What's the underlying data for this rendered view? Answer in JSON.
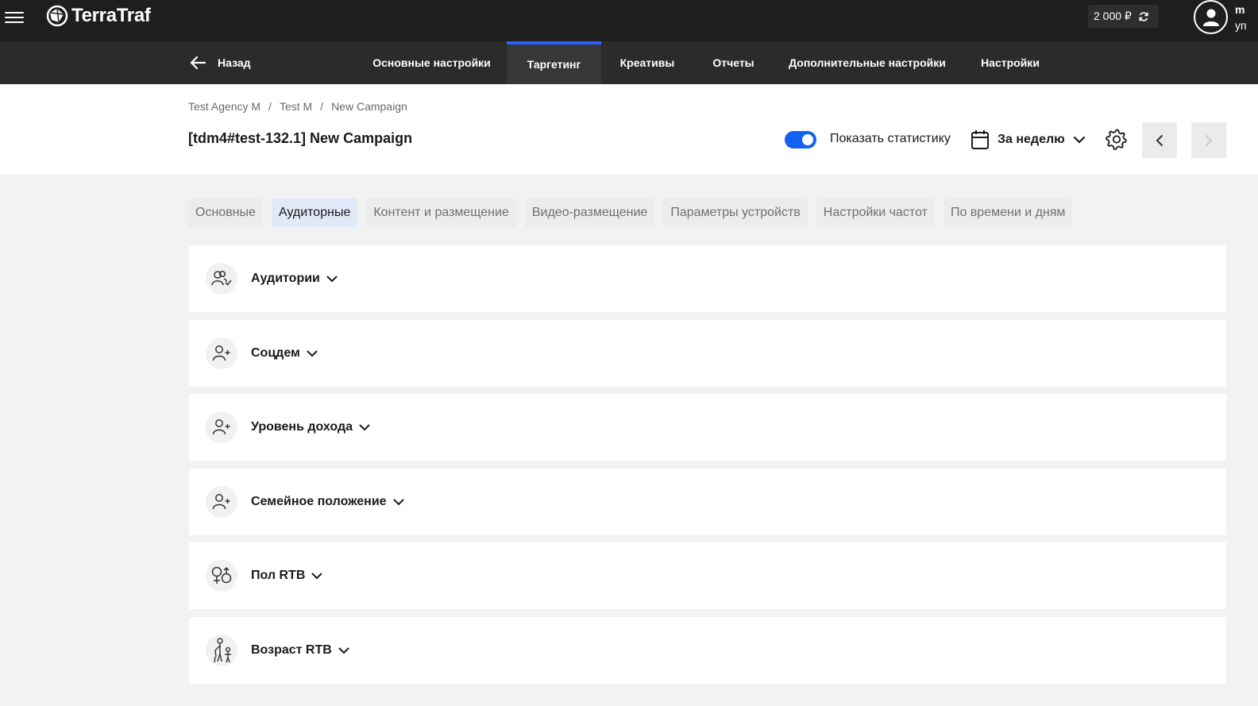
{
  "topbar": {
    "logo_text": "TerraTraf",
    "balance": "2 000 ₽",
    "user_initial": "m",
    "user_line2": "уп"
  },
  "nav": {
    "back_label": "Назад",
    "tabs": [
      {
        "label": "Основные настройки"
      },
      {
        "label": "Таргетинг"
      },
      {
        "label": "Креативы"
      },
      {
        "label": "Отчеты"
      },
      {
        "label": "Дополнительные настройки"
      },
      {
        "label": "Настройки"
      }
    ],
    "active_tab": "Таргетинг"
  },
  "breadcrumb": [
    "Test Agency M",
    "Test M",
    "New Campaign"
  ],
  "page_title": "[tdm4#test-132.1] New Campaign",
  "stats_toggle": {
    "label": "Показать статистику",
    "on": true
  },
  "period": {
    "label": "За неделю"
  },
  "subtabs": {
    "items": [
      {
        "label": "Основные"
      },
      {
        "label": "Аудиторные"
      },
      {
        "label": "Контент и размещение"
      },
      {
        "label": "Видео-размещение"
      },
      {
        "label": "Параметры устройств"
      },
      {
        "label": "Настройки частот"
      },
      {
        "label": "По времени и дням"
      }
    ],
    "active": "Аудиторные"
  },
  "sections": [
    {
      "label": "Аудитории",
      "icon": "users-check-icon"
    },
    {
      "label": "Соцдем",
      "icon": "user-plus-icon"
    },
    {
      "label": "Уровень дохода",
      "icon": "user-plus-icon"
    },
    {
      "label": "Семейное положение",
      "icon": "user-plus-icon"
    },
    {
      "label": "Пол RTB",
      "icon": "gender-icon"
    },
    {
      "label": "Возраст RTB",
      "icon": "age-icon"
    }
  ],
  "colors": {
    "topbar": "#1e1e1e",
    "navbar": "#2b2b2b",
    "accent": "#1460f2",
    "page_bg": "#f2f2f2"
  }
}
